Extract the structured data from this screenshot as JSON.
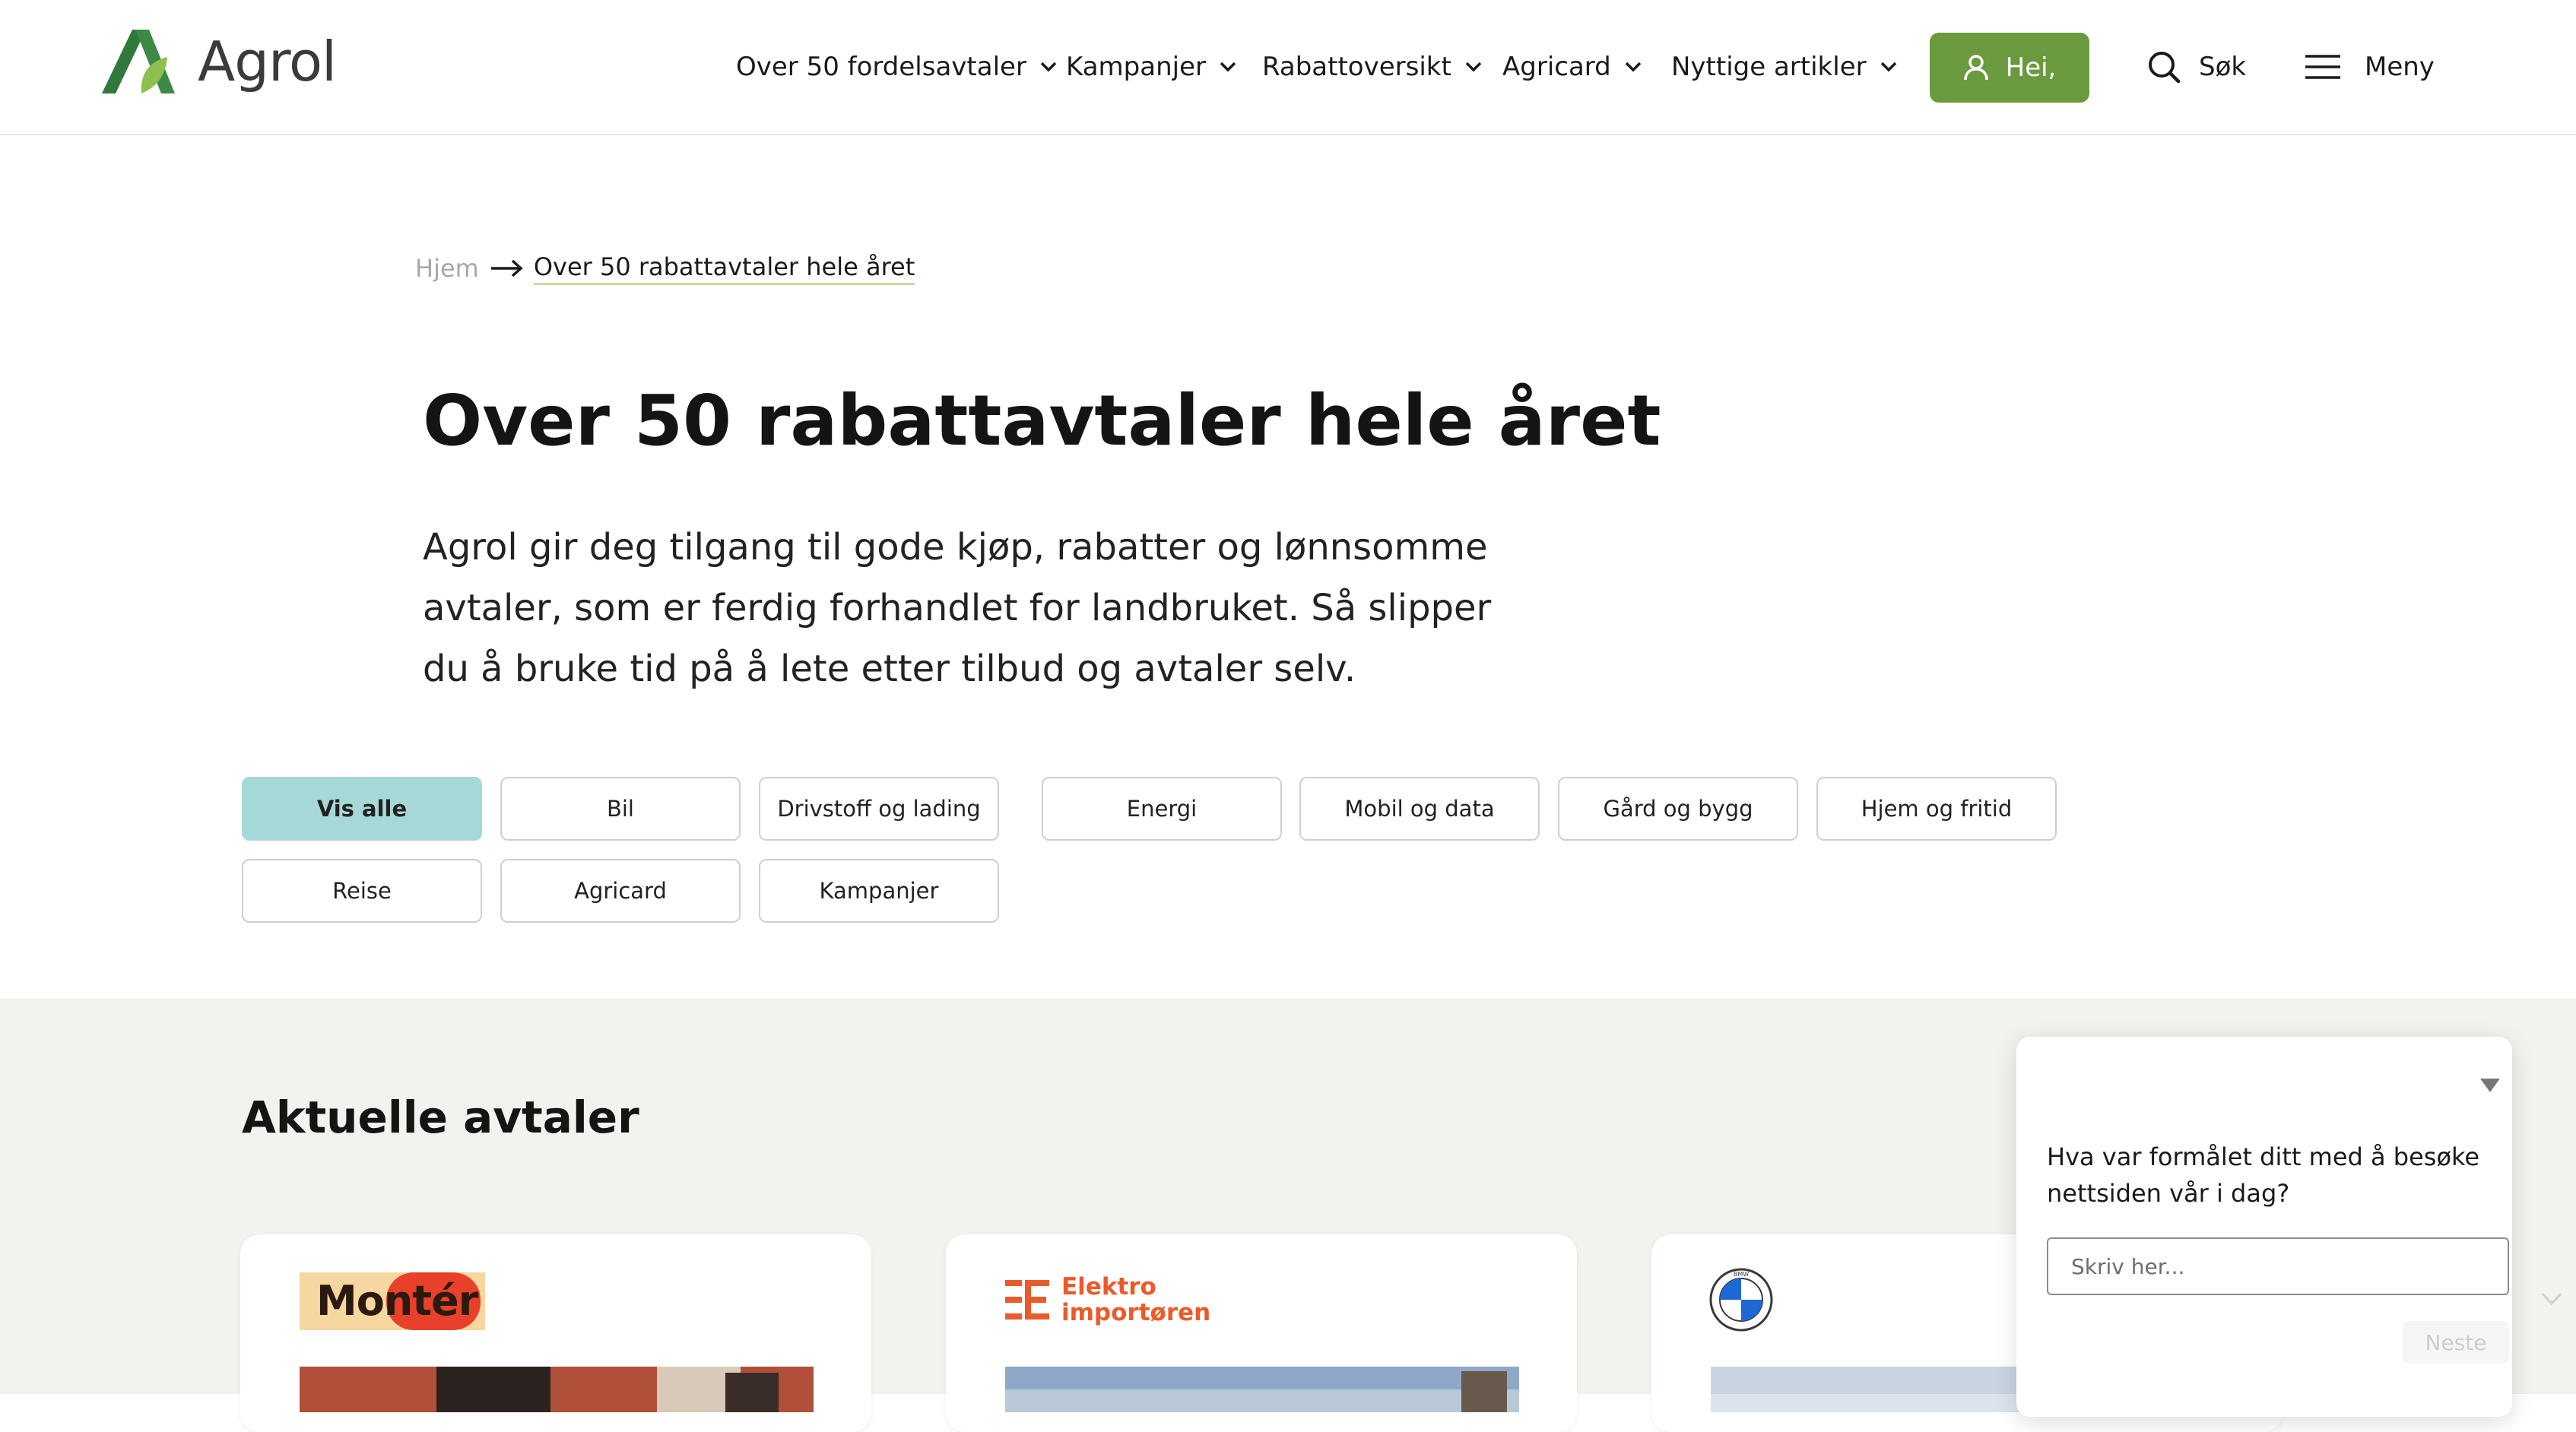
{
  "header": {
    "logo_text": "Agrol",
    "nav": [
      {
        "label": "Over 50 fordelsavtaler"
      },
      {
        "label": "Kampanjer"
      },
      {
        "label": "Rabattoversikt"
      },
      {
        "label": "Agricard"
      },
      {
        "label": "Nyttige artikler"
      }
    ],
    "hello_label": "Hei,",
    "search_label": "Søk",
    "menu_label": "Meny"
  },
  "breadcrumb": {
    "home": "Hjem",
    "current": "Over 50 rabattavtaler hele året"
  },
  "page": {
    "title": "Over 50 rabattavtaler hele året",
    "intro": "Agrol gir deg tilgang til gode kjøp, rabatter og lønnsomme avtaler, som er ferdig forhandlet for landbruket. Så slipper du å bruke tid på å lete etter tilbud og avtaler selv."
  },
  "filters": {
    "active": "Vis alle",
    "items": [
      "Vis alle",
      "Bil",
      "Drivstoff og lading",
      "Energi",
      "Mobil og data",
      "Gård og bygg",
      "Hjem og fritid",
      "Reise",
      "Agricard",
      "Kampanjer"
    ]
  },
  "deals": {
    "title": "Aktuelle avtaler",
    "cards": [
      {
        "brand": "Montér"
      },
      {
        "brand_line1": "Elektro",
        "brand_line2": "importøren"
      },
      {
        "brand": "BMW"
      }
    ]
  },
  "survey": {
    "question": "Hva var formålet ditt med å besøke nettsiden vår i dag?",
    "placeholder": "Skriv her...",
    "next_label": "Neste"
  },
  "colors": {
    "brand_green": "#6b9a3e",
    "chip_active": "#a7d8d8",
    "section_bg": "#f4f2ee",
    "elektro_orange": "#ea5b2a",
    "monter_red": "#e8402a"
  }
}
